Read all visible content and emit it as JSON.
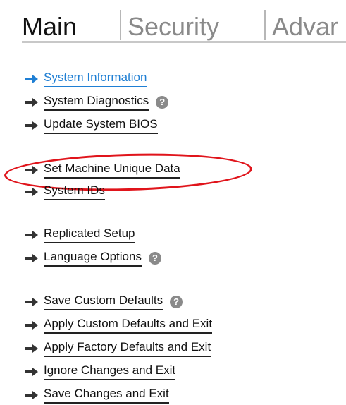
{
  "tabs": [
    {
      "label": "Main",
      "active": true
    },
    {
      "label": "Security",
      "active": false
    },
    {
      "label": "Advar",
      "active": false
    }
  ],
  "menu": {
    "items": [
      {
        "label": "System Information",
        "selected": true,
        "help": false
      },
      {
        "label": "System Diagnostics",
        "selected": false,
        "help": true
      },
      {
        "label": "Update System BIOS",
        "selected": false,
        "help": false
      },
      {
        "label": "Set Machine Unique Data",
        "selected": false,
        "help": false,
        "highlighted": true
      },
      {
        "label": "System IDs",
        "selected": false,
        "help": false
      },
      {
        "label": "Replicated Setup",
        "selected": false,
        "help": false
      },
      {
        "label": "Language Options",
        "selected": false,
        "help": true
      },
      {
        "label": "Save Custom Defaults",
        "selected": false,
        "help": true
      },
      {
        "label": "Apply Custom Defaults and Exit",
        "selected": false,
        "help": false
      },
      {
        "label": "Apply Factory Defaults and Exit",
        "selected": false,
        "help": false
      },
      {
        "label": "Ignore Changes and Exit",
        "selected": false,
        "help": false
      },
      {
        "label": "Save Changes and Exit",
        "selected": false,
        "help": false
      }
    ]
  },
  "icons": {
    "arrow": "arrow-right-icon",
    "help": "question-mark-icon"
  },
  "help_glyph": "?",
  "colors": {
    "selected": "#1f7fd4",
    "text": "#111111",
    "inactive_tab": "#8a8a8a",
    "highlight": "#e0141b"
  }
}
